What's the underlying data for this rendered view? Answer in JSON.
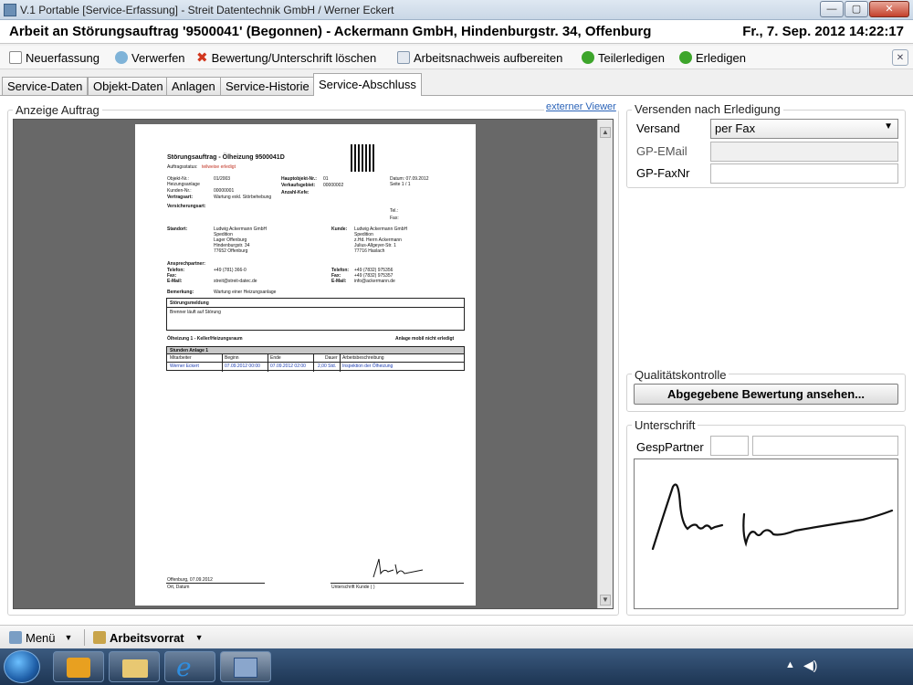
{
  "window": {
    "title": "V.1 Portable [Service-Erfassung] - Streit Datentechnik GmbH / Werner Eckert",
    "minimize": "—",
    "maximize": "▢",
    "close": "✕"
  },
  "header": {
    "title": "Arbeit an Störungsauftrag '9500041' (Begonnen) - Ackermann GmbH, Hindenburgstr. 34, Offenburg",
    "datetime": "Fr., 7. Sep. 2012 14:22:17"
  },
  "toolbar": {
    "new": "Neuerfassung",
    "discard": "Verwerfen",
    "delete_rating": "Bewertung/Unterschrift löschen",
    "prepare_report": "Arbeitsnachweis aufbereiten",
    "partial_complete": "Teilerledigen",
    "complete": "Erledigen",
    "close_x": "✕"
  },
  "tabs": [
    "Service-Daten",
    "Objekt-Daten",
    "Anlagen",
    "Service-Historie",
    "Service-Abschluss"
  ],
  "order_display": {
    "label": "Anzeige Auftrag",
    "external_viewer": "externer Viewer"
  },
  "document": {
    "heading": "Störungsauftrag - Ölheizung 9500041D",
    "status_label": "Auftragsstatus:",
    "status_value": "teilweise erledigt",
    "object_no_label": "Objekt-Nr.:",
    "object_no": "01/2003",
    "object_name": "Heizungsanlage",
    "customer_no_label": "Kunden-Nr.:",
    "customer_no": "00000001",
    "contract_label": "Vertragsart:",
    "contract": "Wartung exkl. Störbehebung",
    "insurance_label": "Versicherungsart:",
    "main_object_label": "Hauptobjekt-Nr.:",
    "main_object": "01",
    "sales_area_label": "Verkaufsgebiet:",
    "sales_area": "00000002",
    "calls_label": "Anzahl-Kefe:",
    "date_label": "Datum: 07.09.2012",
    "page_label": "Seite 1 / 1",
    "tel_label": "Tel.:",
    "fax_label": "Fax:",
    "location_label": "Standort:",
    "location_lines": [
      "Ludwig Ackermann GmbH",
      "Spedition",
      "Lager Offenburg",
      "Hindenburgstr. 34",
      "77652 Offenburg"
    ],
    "customer_label": "Kunde:",
    "customer_lines": [
      "Ludwig Ackermann GmbH",
      "Spedition",
      "z.Hd. Herrn Ackermann",
      "Julius-Allgeyer-Str. 1",
      "77716 Haslach"
    ],
    "contact_label": "Ansprechpartner:",
    "phone_label": "Telefon:",
    "phone": "+49 (781) 366-0",
    "fax2_label": "Fax:",
    "email_label": "E-Mail:",
    "email": "streit@streit-datec.de",
    "cust_phone_label": "Telefon:",
    "cust_phone": "+49 (7832) 975356",
    "cust_fax_label": "Fax:",
    "cust_fax": "+49 (7832) 975357",
    "cust_email_label": "E-Mail:",
    "cust_email": "info@ackermann.de",
    "remark_label": "Bemerkung:",
    "remark": "Wartung einer Heizungsanlage",
    "fault_label": "Störungsmeldung",
    "fault_text": "Brenner läuft auf Störung",
    "system_line": "Ölheizung 1 - Keller/Heizungsraum",
    "system_status": "Anlage mobil nicht erledigt",
    "hours_heading": "Stunden Anlage 1",
    "hours_columns": [
      "Mitarbeiter",
      "Beginn",
      "Ende",
      "Dauer",
      "Arbeitsbeschreibung"
    ],
    "hours_row": [
      "Werner Eckert",
      "07.09.2012 00:00",
      "07.09.2012 02:00",
      "2,00 Std.",
      "Inspektion der Ölheizung"
    ],
    "place_date": "Offenburg, 07.09.2012",
    "place_date_caption": "Ort, Datum",
    "signature_caption": "Unterschrift Kunde ( )"
  },
  "send": {
    "label": "Versenden nach Erledigung",
    "dispatch_label": "Versand",
    "dispatch_value": "per Fax",
    "email_label": "GP-EMail",
    "email_value": "",
    "fax_label": "GP-FaxNr",
    "fax_value": ""
  },
  "quality": {
    "label": "Qualitätskontrolle",
    "button": "Abgegebene Bewertung ansehen..."
  },
  "signature": {
    "label": "Unterschrift",
    "partner_label": "GespPartner",
    "partner_short": "",
    "partner_name": ""
  },
  "statusbar": {
    "menu": "Menü",
    "work_stock": "Arbeitsvorrat"
  }
}
